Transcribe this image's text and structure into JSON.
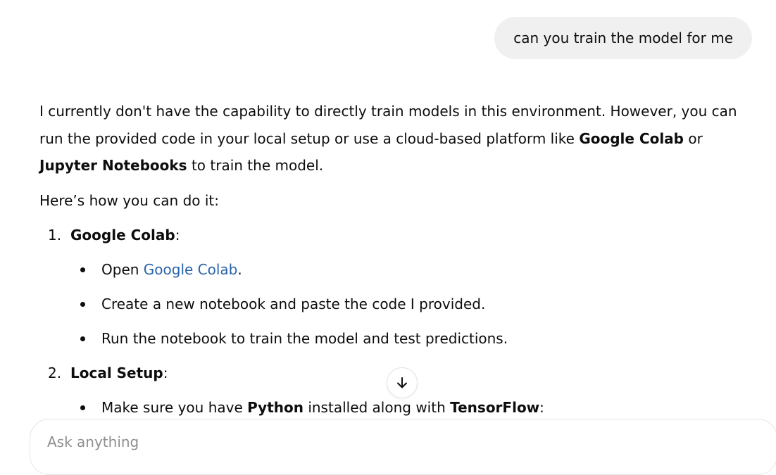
{
  "user_message": "can you train the model for me",
  "response": {
    "intro": {
      "t1": "I currently don't have the capability to directly train models in this environment. However, you can run the provided code in your local setup or use a cloud-based platform like ",
      "b1": "Google Colab",
      "t2": " or ",
      "b2": "Jupyter Notebooks",
      "t3": " to train the model."
    },
    "how_to": "Here’s how you can do it:",
    "steps": [
      {
        "number": "1.",
        "title": "Google Colab",
        "suffix": ":",
        "bullets": {
          "open_prefix": "Open ",
          "open_link": "Google Colab",
          "open_suffix": ".",
          "create": "Create a new notebook and paste the code I provided.",
          "run": "Run the notebook to train the model and test predictions."
        }
      },
      {
        "number": "2.",
        "title": "Local Setup",
        "suffix": ":",
        "bullets": {
          "t1": "Make sure you have ",
          "b1": "Python",
          "t2": " installed along with ",
          "b2": "TensorFlow",
          "t3": ":"
        }
      }
    ]
  },
  "composer": {
    "placeholder": "Ask anything"
  },
  "colors": {
    "link": "#2964aa",
    "bubble": "#f0f0f0",
    "text": "#0d0d0d"
  },
  "icons": {
    "scroll": "arrow-down-icon"
  }
}
